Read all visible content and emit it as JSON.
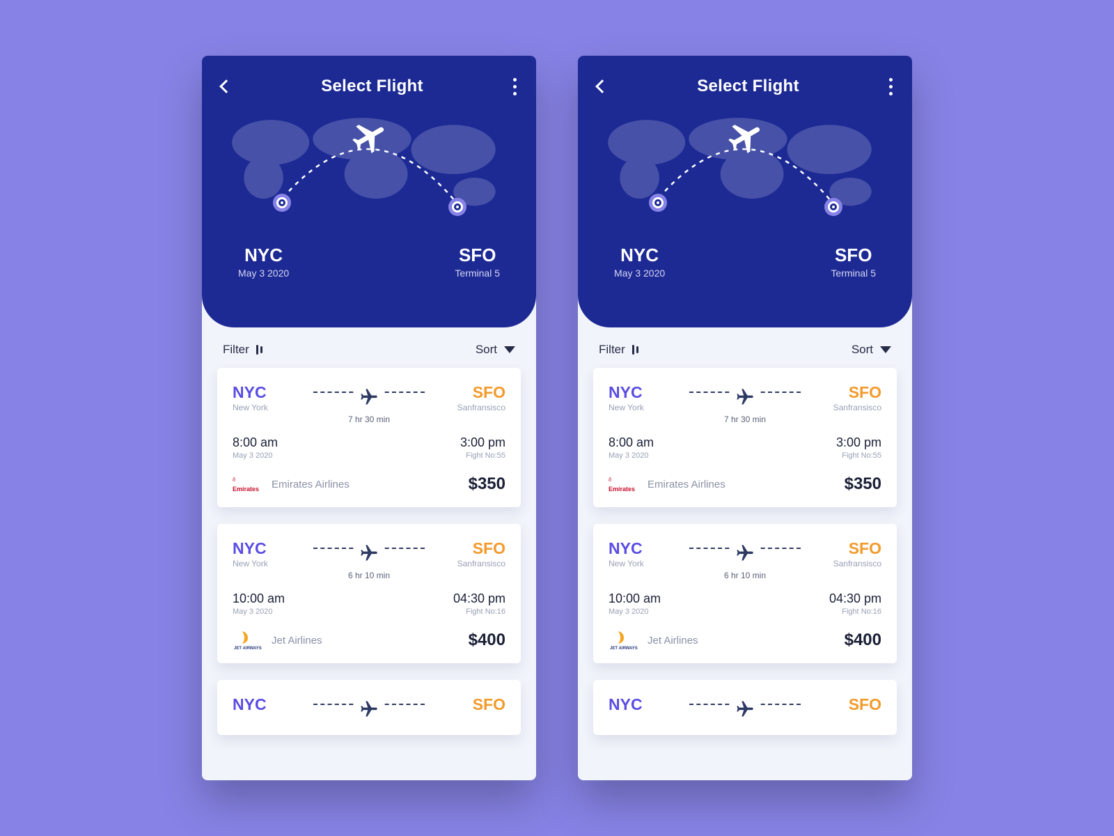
{
  "header": {
    "title": "Select Flight",
    "origin": {
      "code": "NYC",
      "sub": "May 3 2020"
    },
    "destination": {
      "code": "SFO",
      "sub": "Terminal 5"
    }
  },
  "actions": {
    "filter": "Filter",
    "sort": "Sort"
  },
  "flights": [
    {
      "from": {
        "code": "NYC",
        "city": "New York"
      },
      "to": {
        "code": "SFO",
        "city": "Sanfransisco"
      },
      "duration": "7 hr 30 min",
      "depart": {
        "time": "8:00 am",
        "sub": "May 3 2020"
      },
      "arrive": {
        "time": "3:00 pm",
        "sub": "Fight No:55"
      },
      "airline": {
        "name": "Emirates Airlines",
        "logo": "emirates"
      },
      "price": "$350"
    },
    {
      "from": {
        "code": "NYC",
        "city": "New York"
      },
      "to": {
        "code": "SFO",
        "city": "Sanfransisco"
      },
      "duration": "6 hr 10 min",
      "depart": {
        "time": "10:00 am",
        "sub": "May 3 2020"
      },
      "arrive": {
        "time": "04:30 pm",
        "sub": "Fight No:16"
      },
      "airline": {
        "name": "Jet Airlines",
        "logo": "jet"
      },
      "price": "$400"
    },
    {
      "from": {
        "code": "NYC",
        "city": ""
      },
      "to": {
        "code": "SFO",
        "city": ""
      },
      "duration": "",
      "depart": {
        "time": "",
        "sub": ""
      },
      "arrive": {
        "time": "",
        "sub": ""
      },
      "airline": {
        "name": "",
        "logo": ""
      },
      "price": ""
    }
  ]
}
